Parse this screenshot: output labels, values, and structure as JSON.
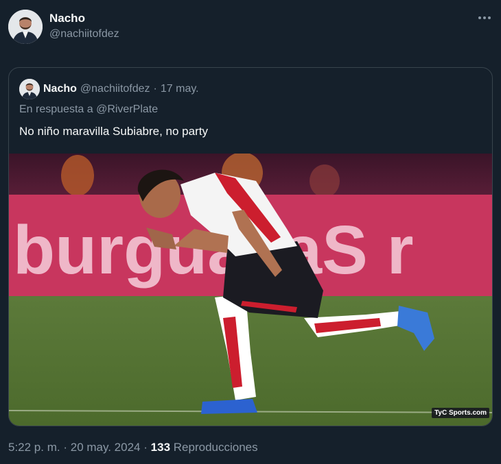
{
  "author": {
    "name": "Nacho",
    "handle": "@nachiitofdez"
  },
  "more_icon": "three-dots-icon",
  "quoted": {
    "name": "Nacho",
    "handle": "@nachiitofdez",
    "separator": "·",
    "date": "17 may.",
    "reply_prefix": "En respuesta a",
    "reply_to": "@RiverPlate",
    "text": "No niño maravilla Subiabre, no party",
    "media": {
      "banner_text": "burguаsaS r",
      "watermark": "TyC Sports.com"
    }
  },
  "footer": {
    "time": "5:22 p. m.",
    "sep1": "·",
    "date": "20 may. 2024",
    "sep2": "·",
    "views_count": "133",
    "views_label": "Reproducciones"
  },
  "colors": {
    "background": "#15202b",
    "text": "#f7f9f9",
    "secondary": "#8b98a5",
    "border": "#38444d"
  }
}
